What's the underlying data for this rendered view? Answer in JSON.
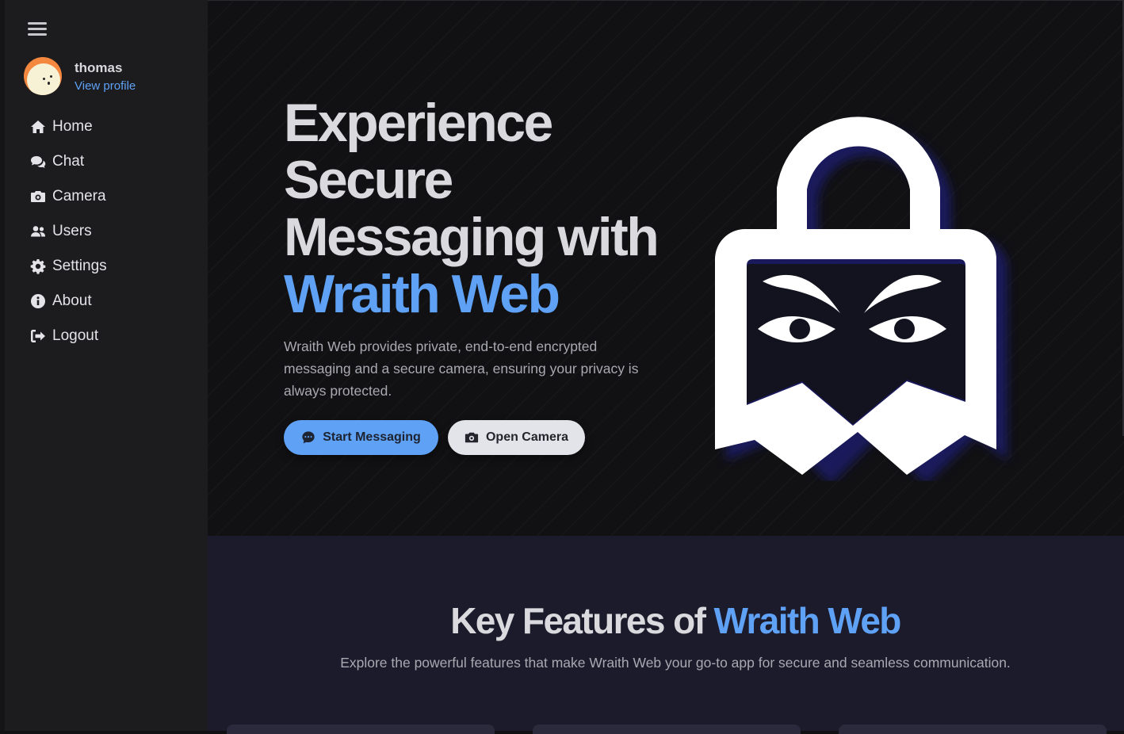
{
  "sidebar": {
    "user": {
      "name": "thomas",
      "view_profile": "View profile"
    },
    "items": [
      {
        "label": "Home",
        "icon": "home-icon"
      },
      {
        "label": "Chat",
        "icon": "chat-icon"
      },
      {
        "label": "Camera",
        "icon": "camera-icon"
      },
      {
        "label": "Users",
        "icon": "users-icon"
      },
      {
        "label": "Settings",
        "icon": "gear-icon"
      },
      {
        "label": "About",
        "icon": "info-icon"
      },
      {
        "label": "Logout",
        "icon": "logout-icon"
      }
    ]
  },
  "hero": {
    "title_line1": "Experience",
    "title_line2": "Secure",
    "title_line3": "Messaging with",
    "title_accent": "Wraith Web",
    "description": "Wraith Web provides private, end-to-end encrypted messaging and a secure camera, ensuring your privacy is always protected.",
    "primary_button": "Start Messaging",
    "secondary_button": "Open Camera"
  },
  "features": {
    "title_prefix": "Key Features of ",
    "title_accent": "Wraith Web",
    "subtitle": "Explore the powerful features that make Wraith Web your go-to app for secure and seamless communication."
  },
  "colors": {
    "accent": "#5ea1f5",
    "sidebar_bg": "#1c1c1e",
    "hero_bg": "#111113",
    "features_bg": "#1c1b2b"
  }
}
